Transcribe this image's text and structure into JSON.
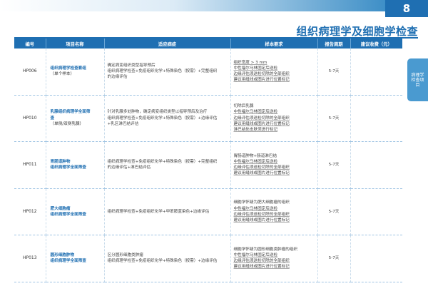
{
  "page_number": "8",
  "page_title": "组织病理学及细胞学检查",
  "side_tab": "病理学检查项目",
  "columns": [
    "编号",
    "项目名称",
    "适应病症",
    "样本要求",
    "报告周期",
    "建议收费（元）"
  ],
  "rows": [
    {
      "code": "HP006",
      "name": [
        "组织病理学检查套组"
      ],
      "note": "（单个样本）",
      "indication": [
        "确定病变组织类型指导预后",
        "组织病理学检查+免疫组织化学+特殊染色（按需）+完整组织",
        "的边缘评估"
      ],
      "sample": [
        "组织宽度 > 3 mm",
        "中性福尔马林固定后送检",
        "边缘评估须送检切除的全部组织",
        "建议用缝线或图片进行位置标记"
      ],
      "period": "5-7天",
      "fee": ""
    },
    {
      "code": "HP010",
      "name": [
        "乳腺组织病理学全面筛",
        "查"
      ],
      "note": "（单侧/双侧乳腺）",
      "indication": [
        "针对乳腺多处肿物，确定病变组织类型以指导预后及治疗",
        "组织病理学检查+免疫组织化学+特殊染色（按需）+边缘评估",
        "+乳区淋巴结评估"
      ],
      "sample": [
        "切除后乳腺",
        "中性福尔马林固定后送检",
        "边缘评估须送检切除的全部组织",
        "建议用缝线或图片进行位置标记",
        "淋巴结处皮肤须进行标记"
      ],
      "period": "5-7天",
      "fee": ""
    },
    {
      "code": "HP011",
      "name": [
        "胃肠道肿物",
        "组织病理学全面筛查"
      ],
      "note": "",
      "indication": [
        "组织病理学检查+免疫组织化学+特殊染色（按需）+完整组织",
        "的边缘评估+淋巴结评估"
      ],
      "sample": [
        "胃肠道肿物+肠道淋巴结",
        "中性福尔马林固定后送检",
        "边缘评估须送检切除的全部组织",
        "建议用缝线或图片进行位置标记"
      ],
      "period": "5-7天",
      "fee": ""
    },
    {
      "code": "HP012",
      "name": [
        "肥大细胞瘤",
        "组织病理学全面筛查"
      ],
      "note": "",
      "indication": [
        "组织病理学检查+免疫组织化学+甲苯胺蓝染色+边缘评估"
      ],
      "sample": [
        "细胞学怀疑为肥大细胞瘤的组织",
        "中性福尔马林固定后送检",
        "边缘评估须送检切除的全部组织",
        "建议用缝线或图片进行位置标记"
      ],
      "period": "5-7天",
      "fee": ""
    },
    {
      "code": "HP013",
      "name": [
        "圆形细胞肿物",
        "组织病理学全面筛查"
      ],
      "note": "",
      "indication": [
        "区分圆形细胞类肿瘤",
        "组织病理学检查+免疫组织化学+特殊染色（按需）+边缘评估"
      ],
      "sample": [
        "细胞学怀疑为圆形细胞类肿瘤的组织",
        "中性福尔马林固定后送检",
        "边缘评估须送检切除的全部组织",
        "建议用缝线或图片进行位置标记"
      ],
      "period": "5-7天",
      "fee": ""
    }
  ]
}
